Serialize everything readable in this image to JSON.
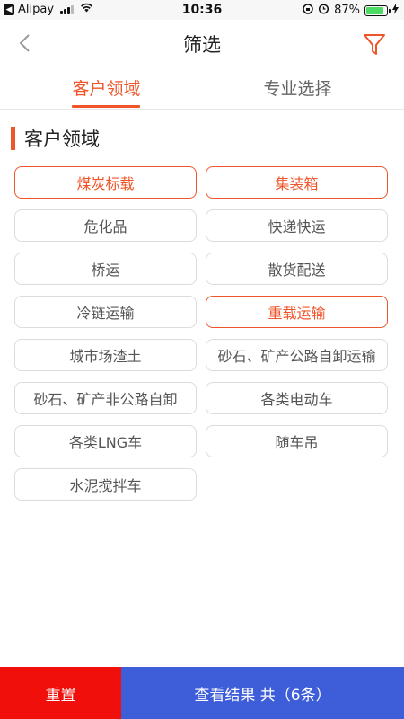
{
  "status_bar": {
    "carrier": "Alipay",
    "time": "10:36",
    "battery": "87%",
    "battery_level": 0.87,
    "battery_color": "#4cd964"
  },
  "nav": {
    "title": "筛选",
    "back_icon": "chevron-left-icon",
    "filter_icon": "funnel-icon"
  },
  "tabs": [
    {
      "label": "客户领域",
      "active": true
    },
    {
      "label": "专业选择",
      "active": false
    }
  ],
  "section": {
    "title": "客户领域"
  },
  "options": [
    {
      "label": "煤炭标载",
      "selected": true
    },
    {
      "label": "集装箱",
      "selected": true
    },
    {
      "label": "危化品",
      "selected": false
    },
    {
      "label": "快递快运",
      "selected": false
    },
    {
      "label": "桥运",
      "selected": false
    },
    {
      "label": "散货配送",
      "selected": false
    },
    {
      "label": "冷链运输",
      "selected": false
    },
    {
      "label": "重载运输",
      "selected": true
    },
    {
      "label": "城市场渣土",
      "selected": false
    },
    {
      "label": "砂石、矿产公路自卸运输",
      "selected": false
    },
    {
      "label": "砂石、矿产非公路自卸",
      "selected": false
    },
    {
      "label": "各类电动车",
      "selected": false
    },
    {
      "label": "各类LNG车",
      "selected": false
    },
    {
      "label": "随车吊",
      "selected": false
    },
    {
      "label": "水泥搅拌车",
      "selected": false
    }
  ],
  "bottom": {
    "reset_label": "重置",
    "results_label": "查看结果 共（6条）"
  },
  "colors": {
    "accent": "#f0552a",
    "reset": "#f00f0a",
    "results": "#3e5dd8"
  }
}
